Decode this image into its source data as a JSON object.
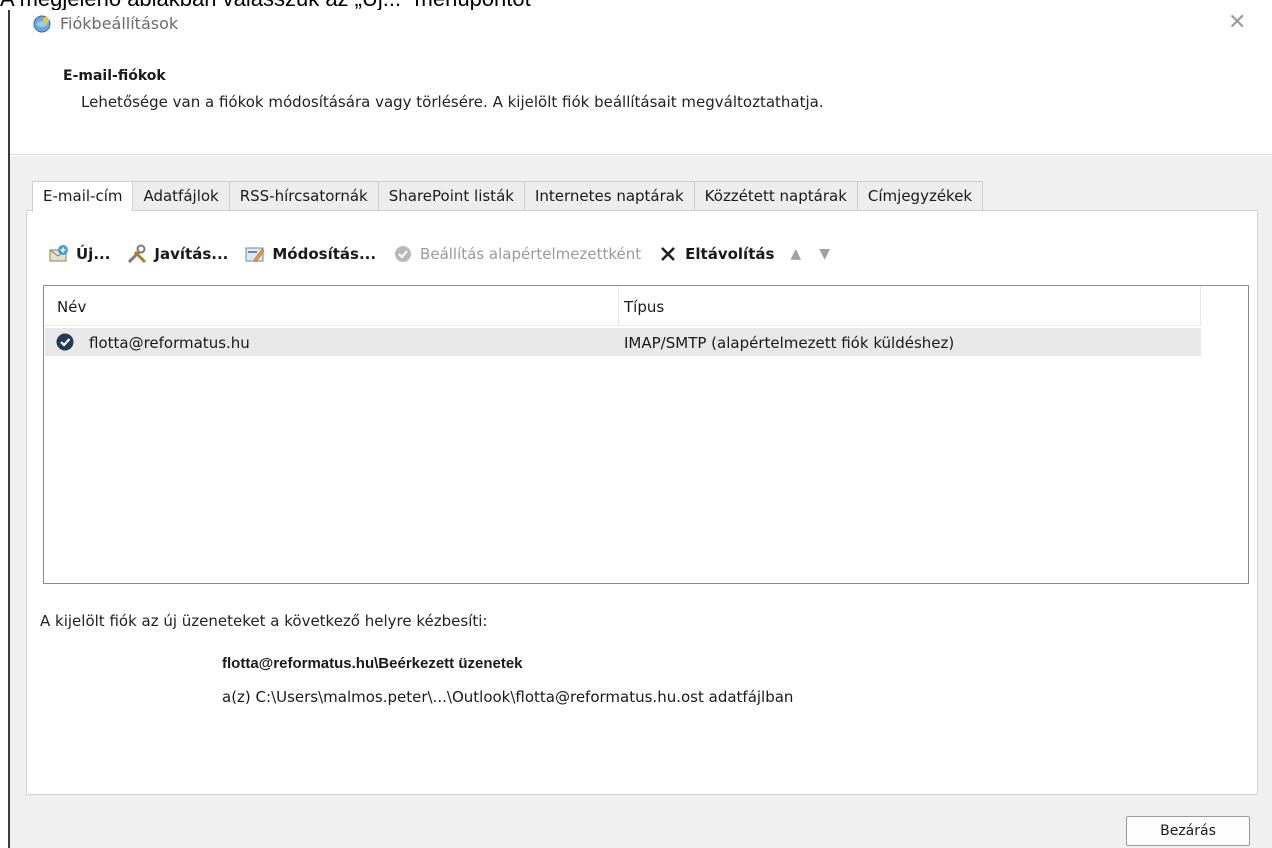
{
  "caption": "A megjelenő ablakban válasszuk az „Új...” menüpontot",
  "window": {
    "title": "Fiókbeállítások",
    "icon": "outlook-account-icon",
    "close_icon": "close-icon"
  },
  "header": {
    "title": "E-mail-fiókok",
    "description": "Lehetősége van a fiókok módosítására vagy törlésére. A kijelölt fiók beállításait megváltoztathatja."
  },
  "tabs": [
    {
      "label": "E-mail-cím",
      "active": true
    },
    {
      "label": "Adatfájlok",
      "active": false
    },
    {
      "label": "RSS-hírcsatornák",
      "active": false
    },
    {
      "label": "SharePoint listák",
      "active": false
    },
    {
      "label": "Internetes naptárak",
      "active": false
    },
    {
      "label": "Közzétett naptárak",
      "active": false
    },
    {
      "label": "Címjegyzékek",
      "active": false
    }
  ],
  "toolbar": {
    "new_label": "Új...",
    "repair_label": "Javítás...",
    "change_label": "Módosítás...",
    "set_default_label": "Beállítás alapértelmezettként",
    "remove_label": "Eltávolítás",
    "move_up_icon": "arrow-up-icon",
    "move_down_icon": "arrow-down-icon"
  },
  "list": {
    "columns": [
      "Név",
      "Típus"
    ],
    "rows": [
      {
        "name": "flotta@reformatus.hu",
        "type": "IMAP/SMTP (alapértelmezett fiók küldéshez)",
        "default": true
      }
    ]
  },
  "delivery": {
    "label": "A kijelölt fiók az új üzeneteket a következő helyre kézbesíti:",
    "folder": "flotta@reformatus.hu\\Beérkezett üzenetek",
    "datafile": "a(z) C:\\Users\\malmos.peter\\...\\Outlook\\flotta@reformatus.hu.ost adatfájlban"
  },
  "buttons": {
    "close": "Bezárás"
  },
  "colors": {
    "content_bg": "#f0f0f0",
    "selected_row": "#e8e8e8"
  }
}
